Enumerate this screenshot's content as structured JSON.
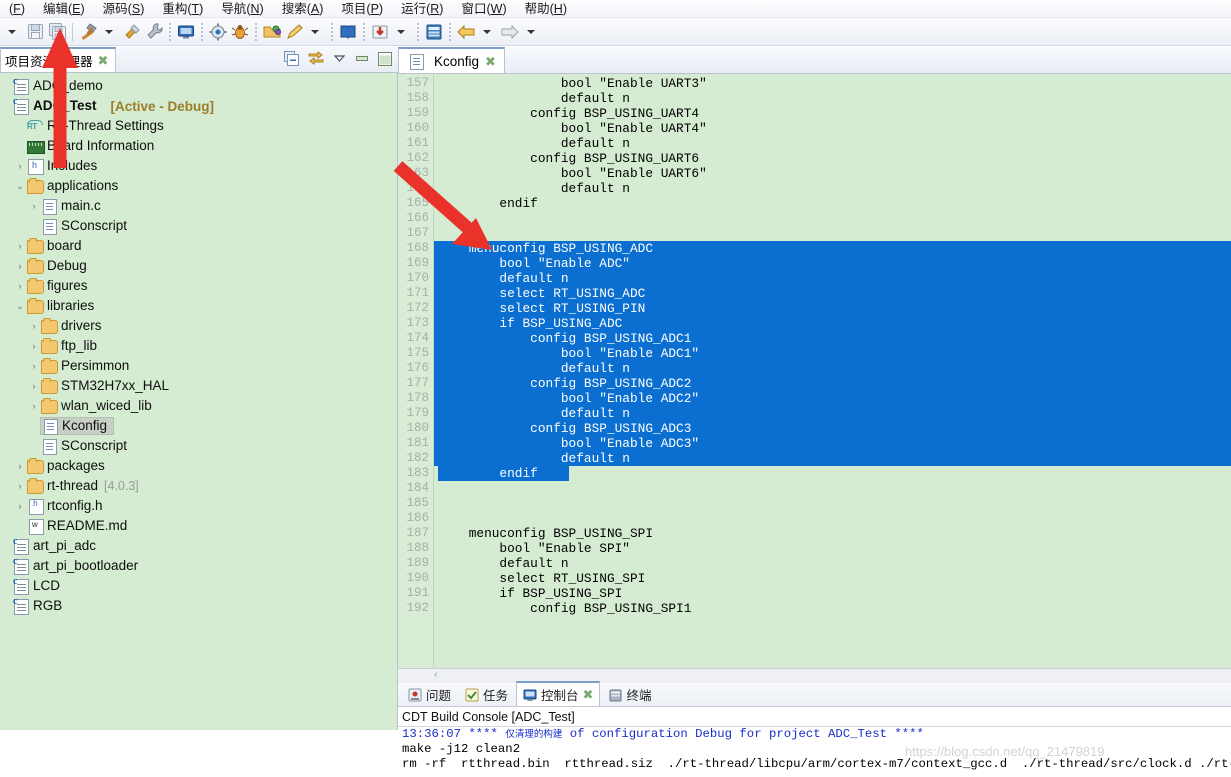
{
  "menubar": {
    "items": [
      {
        "label": "(F)",
        "mnemonic": "F",
        "text": "(F)"
      },
      {
        "label": "编辑(E)"
      },
      {
        "label": "源码(S)"
      },
      {
        "label": "重构(T)"
      },
      {
        "label": "导航(N)"
      },
      {
        "label": "搜索(A)"
      },
      {
        "label": "项目(P)"
      },
      {
        "label": "运行(R)"
      },
      {
        "label": "窗口(W)"
      },
      {
        "label": "帮助(H)"
      }
    ]
  },
  "toolbar": {
    "icons": [
      "dropdown-arrow",
      "save-icon",
      "save-all-icon",
      "separator",
      "build-hammer-icon",
      "build-dropdown-arrow",
      "build-config-icon",
      "wrench-icon",
      "dotsep",
      "console-monitor-icon",
      "dotsep",
      "run-gear-icon",
      "debug-bug-icon",
      "dotsep",
      "open-folder-icon",
      "new-file-pen-icon",
      "pen-dropdown-arrow",
      "dotsep",
      "book-icon",
      "dotsep",
      "import-icon",
      "import-dropdown-arrow",
      "dotsep",
      "terminal-icon",
      "dotsep",
      "back-arrow-icon",
      "back-dropdown-arrow",
      "forward-arrow-icon",
      "forward-dropdown-arrow"
    ]
  },
  "project_explorer": {
    "tab_label": "项目资源管理器",
    "tab_close": "✖",
    "header_icons": [
      "collapse-all-icon",
      "link-with-editor-icon",
      "view-menu-icon",
      "minimize-icon",
      "maximize-icon"
    ],
    "tree": [
      {
        "label": "ADC_demo",
        "icon": "project-c-icon",
        "indent": 0,
        "twisty": "",
        "bold": false
      },
      {
        "label": "ADC_Test",
        "icon": "project-c-icon",
        "indent": 0,
        "twisty": "",
        "bold": true,
        "suffix": "[Active - Debug]"
      },
      {
        "label": "RT-Thread Settings",
        "icon": "rt-thread-icon",
        "indent": 1,
        "twisty": "",
        "bold": false
      },
      {
        "label": "Board Information",
        "icon": "board-icon",
        "indent": 1,
        "twisty": "",
        "bold": false
      },
      {
        "label": "Includes",
        "icon": "includes-icon",
        "indent": 1,
        "twisty": "›",
        "bold": false
      },
      {
        "label": "applications",
        "icon": "folder-icon",
        "indent": 1,
        "twisty": "⌄",
        "bold": false
      },
      {
        "label": "main.c",
        "icon": "c-file-icon",
        "indent": 2,
        "twisty": "›",
        "bold": false
      },
      {
        "label": "SConscript",
        "icon": "file-icon",
        "indent": 2,
        "twisty": "",
        "bold": false
      },
      {
        "label": "board",
        "icon": "folder-icon",
        "indent": 1,
        "twisty": "›",
        "bold": false
      },
      {
        "label": "Debug",
        "icon": "folder-icon",
        "indent": 1,
        "twisty": "›",
        "bold": false
      },
      {
        "label": "figures",
        "icon": "folder-icon",
        "indent": 1,
        "twisty": "›",
        "bold": false
      },
      {
        "label": "libraries",
        "icon": "folder-icon",
        "indent": 1,
        "twisty": "⌄",
        "bold": false
      },
      {
        "label": "drivers",
        "icon": "folder-icon",
        "indent": 2,
        "twisty": "›",
        "bold": false
      },
      {
        "label": "ftp_lib",
        "icon": "folder-icon",
        "indent": 2,
        "twisty": "›",
        "bold": false
      },
      {
        "label": "Persimmon",
        "icon": "folder-icon",
        "indent": 2,
        "twisty": "›",
        "bold": false
      },
      {
        "label": "STM32H7xx_HAL",
        "icon": "folder-icon",
        "indent": 2,
        "twisty": "›",
        "bold": false
      },
      {
        "label": "wlan_wiced_lib",
        "icon": "folder-icon",
        "indent": 2,
        "twisty": "›",
        "bold": false
      },
      {
        "label": "Kconfig",
        "icon": "file-icon",
        "indent": 2,
        "twisty": "",
        "bold": false,
        "selected": true
      },
      {
        "label": "SConscript",
        "icon": "file-icon",
        "indent": 2,
        "twisty": "",
        "bold": false
      },
      {
        "label": "packages",
        "icon": "folder-icon",
        "indent": 1,
        "twisty": "›",
        "bold": false
      },
      {
        "label": "rt-thread",
        "icon": "folder-icon",
        "indent": 1,
        "twisty": "›",
        "bold": false,
        "suffix_dim": "[4.0.3]"
      },
      {
        "label": "rtconfig.h",
        "icon": "h-file-icon",
        "indent": 1,
        "twisty": "›",
        "bold": false
      },
      {
        "label": "README.md",
        "icon": "md-file-icon",
        "indent": 1,
        "twisty": "",
        "bold": false
      },
      {
        "label": "art_pi_adc",
        "icon": "project-c-icon",
        "indent": 0,
        "twisty": "",
        "bold": false
      },
      {
        "label": "art_pi_bootloader",
        "icon": "project-c-icon",
        "indent": 0,
        "twisty": "",
        "bold": false
      },
      {
        "label": "LCD",
        "icon": "project-c-icon",
        "indent": 0,
        "twisty": "",
        "bold": false
      },
      {
        "label": "RGB",
        "icon": "project-c-icon",
        "indent": 0,
        "twisty": "",
        "bold": false
      }
    ]
  },
  "editor": {
    "tab_label": "Kconfig",
    "tab_icon": "file-icon",
    "tab_close": "✖",
    "first_line_number": 157,
    "lines": [
      {
        "n": 157,
        "text": "                bool \"Enable UART3\"",
        "sel": false
      },
      {
        "n": 158,
        "text": "                default n",
        "sel": false
      },
      {
        "n": 159,
        "text": "            config BSP_USING_UART4",
        "sel": false
      },
      {
        "n": 160,
        "text": "                bool \"Enable UART4\"",
        "sel": false
      },
      {
        "n": 161,
        "text": "                default n",
        "sel": false
      },
      {
        "n": 162,
        "text": "            config BSP_USING_UART6",
        "sel": false
      },
      {
        "n": 163,
        "text": "                bool \"Enable UART6\"",
        "sel": false
      },
      {
        "n": 164,
        "text": "                default n",
        "sel": false
      },
      {
        "n": 165,
        "text": "        endif",
        "sel": false
      },
      {
        "n": 166,
        "text": "",
        "sel": false
      },
      {
        "n": 167,
        "text": "",
        "sel": false
      },
      {
        "n": 168,
        "text": "    menuconfig BSP_USING_ADC",
        "sel": true
      },
      {
        "n": 169,
        "text": "        bool \"Enable ADC\"",
        "sel": true
      },
      {
        "n": 170,
        "text": "        default n",
        "sel": true
      },
      {
        "n": 171,
        "text": "        select RT_USING_ADC",
        "sel": true
      },
      {
        "n": 172,
        "text": "        select RT_USING_PIN",
        "sel": true
      },
      {
        "n": 173,
        "text": "        if BSP_USING_ADC",
        "sel": true
      },
      {
        "n": 174,
        "text": "            config BSP_USING_ADC1",
        "sel": true
      },
      {
        "n": 175,
        "text": "                bool \"Enable ADC1\"",
        "sel": true
      },
      {
        "n": 176,
        "text": "                default n",
        "sel": true
      },
      {
        "n": 177,
        "text": "            config BSP_USING_ADC2",
        "sel": true
      },
      {
        "n": 178,
        "text": "                bool \"Enable ADC2\"",
        "sel": true
      },
      {
        "n": 179,
        "text": "                default n",
        "sel": true
      },
      {
        "n": 180,
        "text": "            config BSP_USING_ADC3",
        "sel": true
      },
      {
        "n": 181,
        "text": "                bool \"Enable ADC3\"",
        "sel": true
      },
      {
        "n": 182,
        "text": "                default n",
        "sel": true
      },
      {
        "n": 183,
        "text": "        endif",
        "sel": true,
        "partial": true
      },
      {
        "n": 184,
        "text": "",
        "sel": false
      },
      {
        "n": 185,
        "text": "",
        "sel": false
      },
      {
        "n": 186,
        "text": "",
        "sel": false
      },
      {
        "n": 187,
        "text": "    menuconfig BSP_USING_SPI",
        "sel": false
      },
      {
        "n": 188,
        "text": "        bool \"Enable SPI\"",
        "sel": false
      },
      {
        "n": 189,
        "text": "        default n",
        "sel": false
      },
      {
        "n": 190,
        "text": "        select RT_USING_SPI",
        "sel": false
      },
      {
        "n": 191,
        "text": "        if BSP_USING_SPI",
        "sel": false
      },
      {
        "n": 192,
        "text": "            config BSP_USING_SPI1",
        "sel": false
      }
    ],
    "hscroll_chevron": "‹"
  },
  "console": {
    "tabs": [
      {
        "label": "问题",
        "icon": "problems-icon",
        "active": false
      },
      {
        "label": "任务",
        "icon": "tasks-icon",
        "active": false
      },
      {
        "label": "控制台",
        "icon": "console-icon",
        "active": true,
        "close": "✖"
      },
      {
        "label": "终端",
        "icon": "terminal-icon",
        "active": false
      }
    ],
    "title": "CDT Build Console [ADC_Test]",
    "lines": [
      {
        "prefix": "13:36:07 **** ",
        "cn": "仅清理的构建",
        "suffix": " of configuration Debug for project ADC_Test ****",
        "color": "blue"
      },
      {
        "text": "make -j12 clean2",
        "color": "black"
      },
      {
        "text": "rm -rf  rtthread.bin  rtthread.siz  ./rt-thread/libcpu/arm/cortex-m7/context_gcc.d  ./rt-thread/src/clock.d ./rt-thre",
        "color": "black"
      }
    ]
  },
  "watermark": {
    "text": "https://blog.csdn.net/qq_21479819"
  },
  "colors": {
    "editor_bg": "#d6ecd2",
    "selection_bg": "#0a6fd0",
    "tree_bg": "#d6ecd2",
    "accent": "#7b9ec9",
    "active_debug": "#9b7d2a",
    "console_blue": "#1b2ecb",
    "arrow_red": "#e8322a"
  }
}
